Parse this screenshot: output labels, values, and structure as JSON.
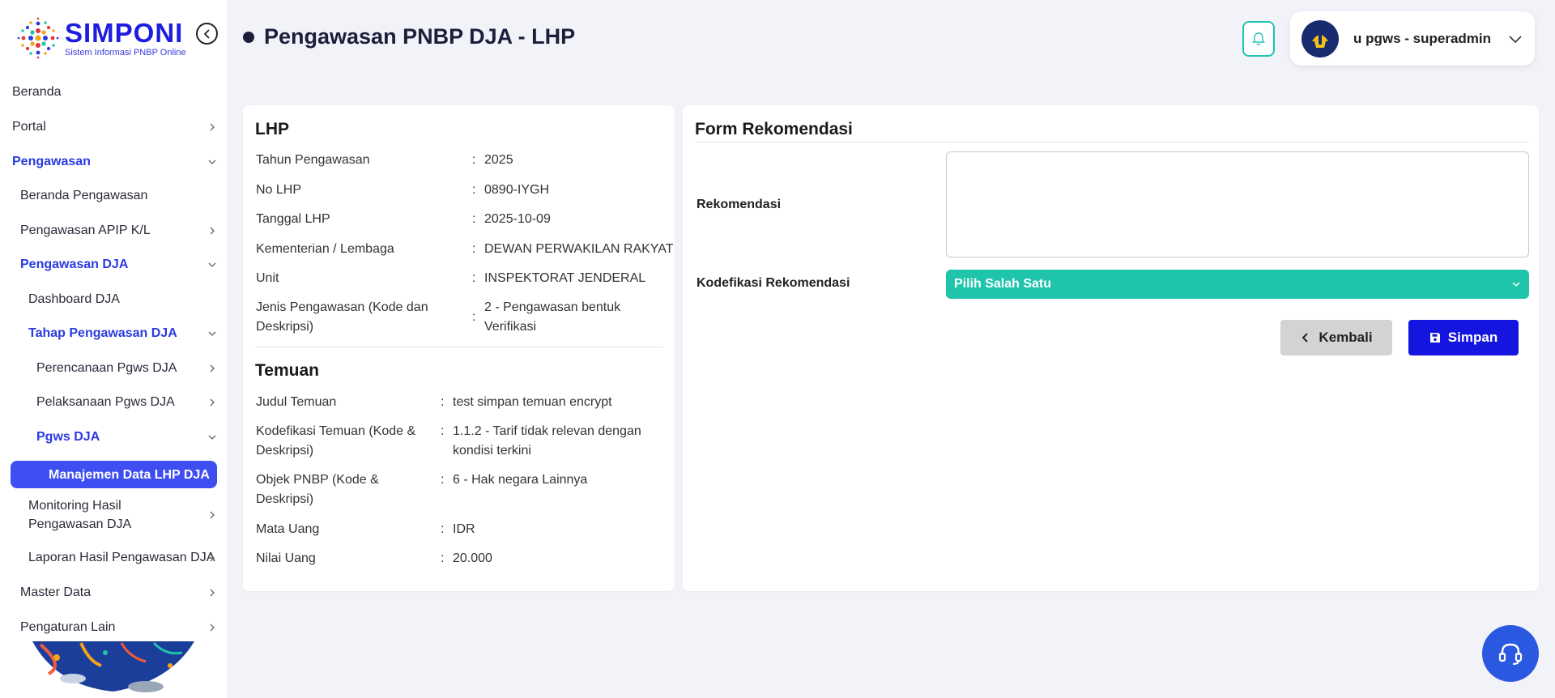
{
  "brand": {
    "title": "SIMPONI",
    "subtitle": "Sistem Informasi PNBP Online"
  },
  "sidebar": {
    "items": [
      {
        "label": "Beranda"
      },
      {
        "label": "Portal"
      },
      {
        "label": "Pengawasan"
      },
      {
        "label": "Beranda Pengawasan"
      },
      {
        "label": "Pengawasan APIP K/L"
      },
      {
        "label": "Pengawasan DJA"
      },
      {
        "label": "Dashboard DJA"
      },
      {
        "label": "Tahap Pengawasan DJA"
      },
      {
        "label": "Perencanaan Pgws DJA"
      },
      {
        "label": "Pelaksanaan Pgws DJA"
      },
      {
        "label": "Pgws DJA"
      },
      {
        "label": "Manajemen Data LHP DJA"
      },
      {
        "label": "Monitoring Hasil Pengawasan DJA"
      },
      {
        "label": "Laporan Hasil Pengawasan DJA"
      },
      {
        "label": "Master Data"
      },
      {
        "label": "Pengaturan Lain"
      }
    ]
  },
  "header": {
    "title": "Pengawasan PNBP DJA - LHP",
    "user_name": "u pgws - superadmin"
  },
  "lhp": {
    "title": "LHP",
    "rows": [
      {
        "key": "Tahun Pengawasan",
        "value": "2025"
      },
      {
        "key": "No LHP",
        "value": "0890-IYGH"
      },
      {
        "key": "Tanggal LHP",
        "value": "2025-10-09"
      },
      {
        "key": "Kementerian / Lembaga",
        "value": "DEWAN PERWAKILAN RAKYAT"
      },
      {
        "key": "Unit",
        "value": "INSPEKTORAT JENDERAL"
      },
      {
        "key": "Jenis Pengawasan (Kode dan Deskripsi)",
        "value": "2 - Pengawasan bentuk Verifikasi"
      }
    ]
  },
  "temuan": {
    "title": "Temuan",
    "rows": [
      {
        "key": "Judul Temuan",
        "value": "test simpan temuan encrypt"
      },
      {
        "key": "Kodefikasi Temuan (Kode & Deskripsi)",
        "value": "1.1.2 - Tarif tidak relevan dengan kondisi terkini"
      },
      {
        "key": "Objek PNBP (Kode & Deskripsi)",
        "value": "6 - Hak negara Lainnya"
      },
      {
        "key": "Mata Uang",
        "value": "IDR"
      },
      {
        "key": "Nilai Uang",
        "value": "20.000"
      }
    ]
  },
  "form": {
    "title": "Form Rekomendasi",
    "rekomendasi_label": "Rekomendasi",
    "rekomendasi_value": "",
    "kodefikasi_label": "Kodefikasi Rekomendasi",
    "kodefikasi_selected": "Pilih Salah Satu",
    "back_label": "Kembali",
    "save_label": "Simpan"
  },
  "colors": {
    "accent": "#3f4ef0",
    "teal": "#1fc4ab",
    "primary_button": "#1515e0",
    "help_button": "#2a58e0"
  },
  "icons": [
    "collapse-icon",
    "bell-icon",
    "chevron-down-icon",
    "chevron-right-icon",
    "chevron-left-icon",
    "save-icon",
    "headset-icon"
  ]
}
